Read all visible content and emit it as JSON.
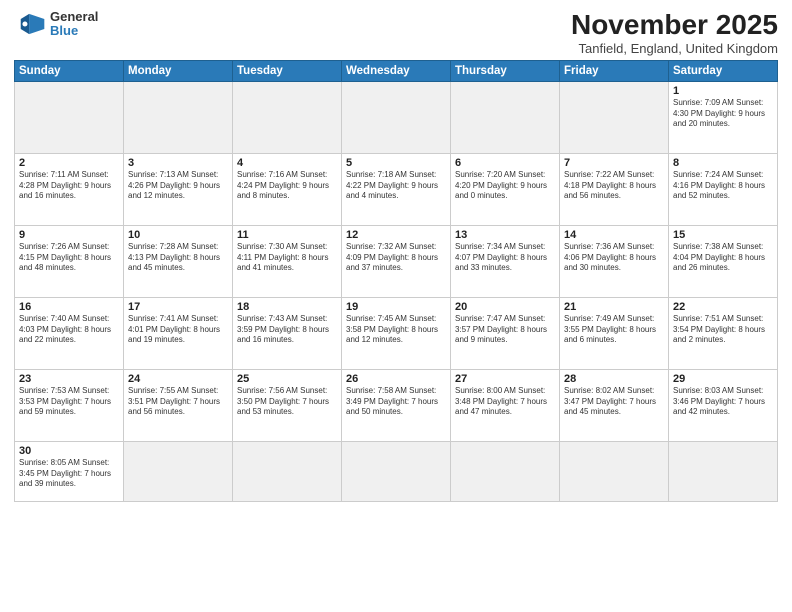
{
  "logo": {
    "general": "General",
    "blue": "Blue"
  },
  "title": "November 2025",
  "location": "Tanfield, England, United Kingdom",
  "days_of_week": [
    "Sunday",
    "Monday",
    "Tuesday",
    "Wednesday",
    "Thursday",
    "Friday",
    "Saturday"
  ],
  "weeks": [
    [
      {
        "day": "",
        "info": "",
        "empty": true
      },
      {
        "day": "",
        "info": "",
        "empty": true
      },
      {
        "day": "",
        "info": "",
        "empty": true
      },
      {
        "day": "",
        "info": "",
        "empty": true
      },
      {
        "day": "",
        "info": "",
        "empty": true
      },
      {
        "day": "",
        "info": "",
        "empty": true
      },
      {
        "day": "1",
        "info": "Sunrise: 7:09 AM\nSunset: 4:30 PM\nDaylight: 9 hours\nand 20 minutes.",
        "empty": false
      }
    ],
    [
      {
        "day": "2",
        "info": "Sunrise: 7:11 AM\nSunset: 4:28 PM\nDaylight: 9 hours\nand 16 minutes.",
        "empty": false
      },
      {
        "day": "3",
        "info": "Sunrise: 7:13 AM\nSunset: 4:26 PM\nDaylight: 9 hours\nand 12 minutes.",
        "empty": false
      },
      {
        "day": "4",
        "info": "Sunrise: 7:16 AM\nSunset: 4:24 PM\nDaylight: 9 hours\nand 8 minutes.",
        "empty": false
      },
      {
        "day": "5",
        "info": "Sunrise: 7:18 AM\nSunset: 4:22 PM\nDaylight: 9 hours\nand 4 minutes.",
        "empty": false
      },
      {
        "day": "6",
        "info": "Sunrise: 7:20 AM\nSunset: 4:20 PM\nDaylight: 9 hours\nand 0 minutes.",
        "empty": false
      },
      {
        "day": "7",
        "info": "Sunrise: 7:22 AM\nSunset: 4:18 PM\nDaylight: 8 hours\nand 56 minutes.",
        "empty": false
      },
      {
        "day": "8",
        "info": "Sunrise: 7:24 AM\nSunset: 4:16 PM\nDaylight: 8 hours\nand 52 minutes.",
        "empty": false
      }
    ],
    [
      {
        "day": "9",
        "info": "Sunrise: 7:26 AM\nSunset: 4:15 PM\nDaylight: 8 hours\nand 48 minutes.",
        "empty": false
      },
      {
        "day": "10",
        "info": "Sunrise: 7:28 AM\nSunset: 4:13 PM\nDaylight: 8 hours\nand 45 minutes.",
        "empty": false
      },
      {
        "day": "11",
        "info": "Sunrise: 7:30 AM\nSunset: 4:11 PM\nDaylight: 8 hours\nand 41 minutes.",
        "empty": false
      },
      {
        "day": "12",
        "info": "Sunrise: 7:32 AM\nSunset: 4:09 PM\nDaylight: 8 hours\nand 37 minutes.",
        "empty": false
      },
      {
        "day": "13",
        "info": "Sunrise: 7:34 AM\nSunset: 4:07 PM\nDaylight: 8 hours\nand 33 minutes.",
        "empty": false
      },
      {
        "day": "14",
        "info": "Sunrise: 7:36 AM\nSunset: 4:06 PM\nDaylight: 8 hours\nand 30 minutes.",
        "empty": false
      },
      {
        "day": "15",
        "info": "Sunrise: 7:38 AM\nSunset: 4:04 PM\nDaylight: 8 hours\nand 26 minutes.",
        "empty": false
      }
    ],
    [
      {
        "day": "16",
        "info": "Sunrise: 7:40 AM\nSunset: 4:03 PM\nDaylight: 8 hours\nand 22 minutes.",
        "empty": false
      },
      {
        "day": "17",
        "info": "Sunrise: 7:41 AM\nSunset: 4:01 PM\nDaylight: 8 hours\nand 19 minutes.",
        "empty": false
      },
      {
        "day": "18",
        "info": "Sunrise: 7:43 AM\nSunset: 3:59 PM\nDaylight: 8 hours\nand 16 minutes.",
        "empty": false
      },
      {
        "day": "19",
        "info": "Sunrise: 7:45 AM\nSunset: 3:58 PM\nDaylight: 8 hours\nand 12 minutes.",
        "empty": false
      },
      {
        "day": "20",
        "info": "Sunrise: 7:47 AM\nSunset: 3:57 PM\nDaylight: 8 hours\nand 9 minutes.",
        "empty": false
      },
      {
        "day": "21",
        "info": "Sunrise: 7:49 AM\nSunset: 3:55 PM\nDaylight: 8 hours\nand 6 minutes.",
        "empty": false
      },
      {
        "day": "22",
        "info": "Sunrise: 7:51 AM\nSunset: 3:54 PM\nDaylight: 8 hours\nand 2 minutes.",
        "empty": false
      }
    ],
    [
      {
        "day": "23",
        "info": "Sunrise: 7:53 AM\nSunset: 3:53 PM\nDaylight: 7 hours\nand 59 minutes.",
        "empty": false
      },
      {
        "day": "24",
        "info": "Sunrise: 7:55 AM\nSunset: 3:51 PM\nDaylight: 7 hours\nand 56 minutes.",
        "empty": false
      },
      {
        "day": "25",
        "info": "Sunrise: 7:56 AM\nSunset: 3:50 PM\nDaylight: 7 hours\nand 53 minutes.",
        "empty": false
      },
      {
        "day": "26",
        "info": "Sunrise: 7:58 AM\nSunset: 3:49 PM\nDaylight: 7 hours\nand 50 minutes.",
        "empty": false
      },
      {
        "day": "27",
        "info": "Sunrise: 8:00 AM\nSunset: 3:48 PM\nDaylight: 7 hours\nand 47 minutes.",
        "empty": false
      },
      {
        "day": "28",
        "info": "Sunrise: 8:02 AM\nSunset: 3:47 PM\nDaylight: 7 hours\nand 45 minutes.",
        "empty": false
      },
      {
        "day": "29",
        "info": "Sunrise: 8:03 AM\nSunset: 3:46 PM\nDaylight: 7 hours\nand 42 minutes.",
        "empty": false
      }
    ],
    [
      {
        "day": "30",
        "info": "Sunrise: 8:05 AM\nSunset: 3:45 PM\nDaylight: 7 hours\nand 39 minutes.",
        "empty": false
      },
      {
        "day": "",
        "info": "",
        "empty": true
      },
      {
        "day": "",
        "info": "",
        "empty": true
      },
      {
        "day": "",
        "info": "",
        "empty": true
      },
      {
        "day": "",
        "info": "",
        "empty": true
      },
      {
        "day": "",
        "info": "",
        "empty": true
      },
      {
        "day": "",
        "info": "",
        "empty": true
      }
    ]
  ]
}
